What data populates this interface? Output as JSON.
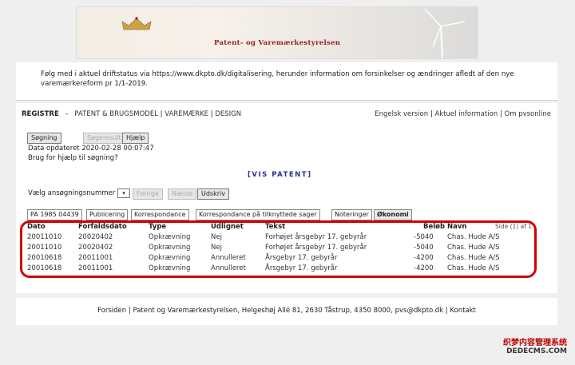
{
  "banner": {
    "brand": "Patent- og Varemærkestyrelsen"
  },
  "notice": {
    "text": "Følg med i aktuel driftstatus via https://www.dkpto.dk/digitalisering, herunder information om forsinkelser og ændringer afledt af den nye varemærkereform pr 1/1-2019."
  },
  "nav": {
    "registre": "REGISTRE",
    "sep": "–",
    "items": [
      "PATENT & BRUGSMODEL",
      "VAREMÆRKE",
      "DESIGN"
    ],
    "right": [
      "Engelsk version",
      "Aktuel information",
      "Om pvsonline"
    ]
  },
  "buttons": {
    "search": "Søgning",
    "results": "Søgeresult",
    "help": "Hjælp"
  },
  "updated": "Data opdateret 2020-02-28 00:07:47",
  "help_text": "Brug for hjælp til søgning?",
  "vis_patent": "[VIS PATENT]",
  "select": {
    "label": "Vælg ansøgningsnummer",
    "value": "",
    "prev": "Forrige",
    "next": "Næste",
    "print": "Udskriv"
  },
  "tabs": [
    "PA 1985 04439",
    "Publicering",
    "Korrespondance",
    "Korrespondance på tilknyttede sager",
    "Noteringer",
    "Økonomi"
  ],
  "table": {
    "headers": [
      "Dato",
      "Forfaldsdato",
      "Type",
      "Udlignet",
      "Tekst",
      "Beløb",
      "Navn"
    ],
    "page_info": "Side (1) af 1",
    "rows": [
      [
        "20011010",
        "20020402",
        "Opkrævning",
        "Nej",
        "Forhøjet årsgebyr 17. gebyrår",
        "-5040",
        "Chas. Hude A/S"
      ],
      [
        "20011010",
        "20020402",
        "Opkrævning",
        "Nej",
        "Forhøjet årsgebyr 17. gebyrår",
        "-5040",
        "Chas. Hude A/S"
      ],
      [
        "20010618",
        "20011001",
        "Opkrævning",
        "Annulleret",
        "Årsgebyr 17. gebyrår",
        "-4200",
        "Chas. Hude A/S"
      ],
      [
        "20010618",
        "20011001",
        "Opkrævning",
        "Annulleret",
        "Årsgebyr 17. gebyrår",
        "-4200",
        "Chas. Hude A/S"
      ]
    ]
  },
  "footer": "Forsiden | Patent og Varemærkestyrelsen, Helgeshøj Allé 81, 2630 Tåstrup, 4350 8000, pvs@dkpto.dk | Kontakt",
  "watermark": {
    "line1": "织梦内容管理系统",
    "line2": "DEDECMS.COM"
  },
  "colors": {
    "brand_red": "#9b1b1b",
    "highlight_red": "#d10000",
    "vis_blue": "#2b2f8f"
  }
}
